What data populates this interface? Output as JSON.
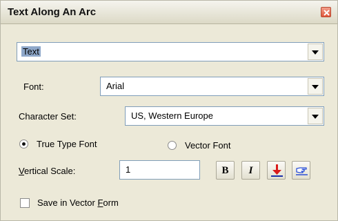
{
  "window": {
    "title": "Text Along An Arc"
  },
  "mode_select": {
    "value": "Text"
  },
  "font": {
    "label": "Font:",
    "value": "Arial"
  },
  "charset": {
    "label": "Character Set:",
    "value": "US, Western Europe"
  },
  "font_type": {
    "true_type_label": "True Type Font",
    "vector_label": "Vector Font",
    "selected": "True Type Font"
  },
  "vertical_scale": {
    "label_prefix": "V",
    "label_rest": "ertical Scale:",
    "value": "1"
  },
  "style_buttons": {
    "bold_glyph": "B",
    "italic_glyph": "I"
  },
  "save_vector": {
    "label_prefix": "Save in Vector ",
    "label_underline": "F",
    "label_rest": "orm",
    "checked": false
  },
  "icons": {
    "close": "close-icon",
    "dropdown": "chevron-down-icon",
    "baseline_arrow": "arrow-down-icon",
    "pointing_hand": "pointing-hand-icon"
  },
  "colors": {
    "dialog_bg": "#ece9d8",
    "close_red": "#e0553a",
    "arrow_red": "#d91a1a",
    "hand_blue": "#2a4fd6"
  }
}
